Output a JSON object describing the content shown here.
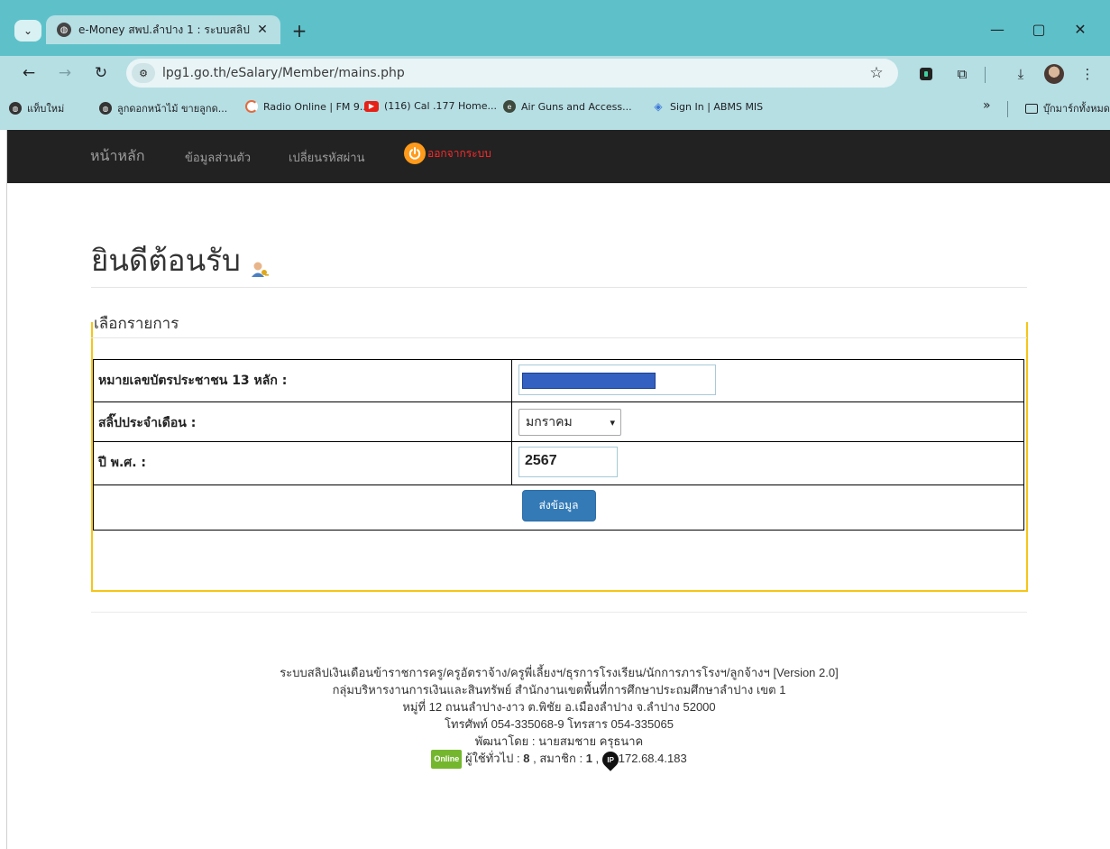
{
  "browser": {
    "tab_title": "e-Money สพป.ลำปาง 1 : ระบบสลิป",
    "url": "lpg1.go.th/eSalary/Member/mains.php",
    "bookmarks": [
      "แท็บใหม่",
      "ลูกดอกหน้าไม้ ขายลูกด...",
      "Radio Online | FM 9...",
      "(116) Cal .177 Home...",
      "Air Guns and Access...",
      "Sign In | ABMS MIS"
    ],
    "bookmarks_more": "»",
    "all_bookmarks": "บุ๊กมาร์กทั้งหมด"
  },
  "navbar": {
    "home": "หน้าหลัก",
    "profile": "ข้อมูลส่วนตัว",
    "change_password": "เปลี่ยนรหัสผ่าน",
    "logout": "ออกจากระบบ"
  },
  "page": {
    "welcome_title": "ยินดีต้อนรับ",
    "panel_legend": "เลือกรายการ"
  },
  "form": {
    "id_label": "หมายเลขบัตรประชาชน 13 หลัก :",
    "slip_label": "สลิ๊ปประจำเดือน :",
    "month_value": "มกราคม",
    "year_label": "ปี พ.ศ. :",
    "year_value": "2567",
    "submit_label": "ส่งข้อมูล"
  },
  "footer": {
    "line1": "ระบบสลิปเงินเดือนข้าราชการครู/ครูอัตราจ้าง/ครูพี่เลี้ยงฯ/ธุรการโรงเรียน/นักการภารโรงฯ/ลูกจ้างฯ  [Version 2.0]",
    "line2": "กลุ่มบริหารงานการเงินและสินทรัพย์ สำนักงานเขตพื้นที่การศึกษาประถมศึกษาลำปาง เขต 1",
    "line3": "หมู่ที่ 12 ถนนลำปาง-งาว ต.พิชัย อ.เมืองลำปาง จ.ลำปาง 52000",
    "line4": "โทรศัพท์ 054-335068-9 โทรสาร 054-335065",
    "line5": "พัฒนาโดย : นายสมชาย ครุธนาค",
    "online_badge": "Online",
    "visitors_label": "ผู้ใช้ทั่วไป :",
    "visitors_count": "8",
    "members_label": ", สมาชิก :",
    "members_count": "1",
    "ip_icon_text": "IP",
    "ip_address": "172.68.4.183"
  },
  "colors": {
    "navbar_bg": "#222222",
    "panel_border": "#f5c518",
    "submit_bg": "#337ab7",
    "logout_text": "#ff2a2a",
    "tabstrip": "#5ec1ca",
    "chrome": "#b6dfe4"
  }
}
